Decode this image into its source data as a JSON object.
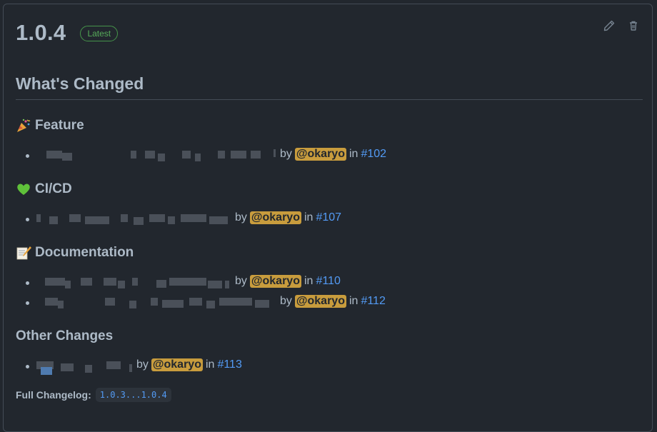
{
  "release": {
    "version": "1.0.4",
    "badge": "Latest"
  },
  "actions": {
    "edit_icon": "pencil-icon",
    "delete_icon": "trash-icon"
  },
  "body": {
    "heading": "What's Changed",
    "sections": [
      {
        "title": "Feature",
        "emoji": "party-popper-icon",
        "items": [
          {
            "by": "by",
            "author": "@okaryo",
            "in": "in",
            "pr": "#102"
          }
        ]
      },
      {
        "title": "CI/CD",
        "emoji": "green-heart-icon",
        "items": [
          {
            "by": "by",
            "author": "@okaryo",
            "in": "in",
            "pr": "#107"
          }
        ]
      },
      {
        "title": "Documentation",
        "emoji": "memo-icon",
        "items": [
          {
            "by": "by",
            "author": "@okaryo",
            "in": "in",
            "pr": "#110"
          },
          {
            "by": "by",
            "author": "@okaryo",
            "in": "in",
            "pr": "#112"
          }
        ]
      },
      {
        "title": "Other Changes",
        "items": [
          {
            "by": "by",
            "author": "@okaryo",
            "in": "in",
            "pr": "#113"
          }
        ]
      }
    ],
    "full_changelog_label": "Full Changelog:",
    "full_changelog_link": "1.0.3...1.0.4"
  },
  "colors": {
    "background": "#22272e",
    "border": "#444c56",
    "text": "#adbac7",
    "link": "#539bf5",
    "badge_green": "#57ab5a",
    "mention_bg": "#daaa3f"
  }
}
